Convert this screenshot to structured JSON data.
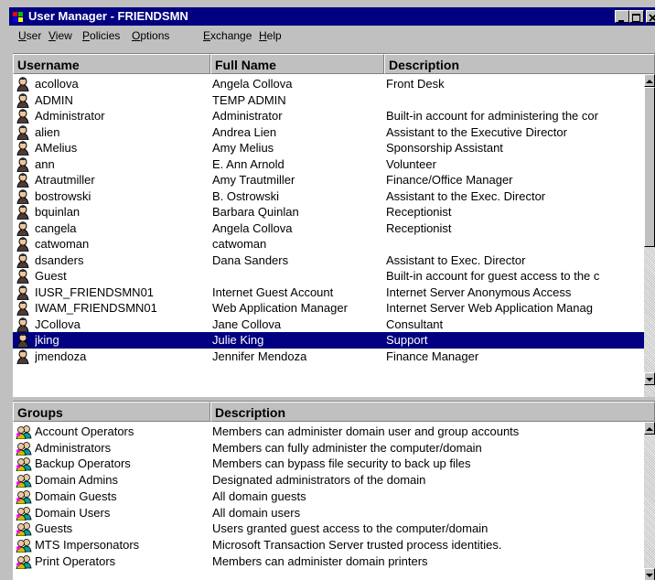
{
  "window": {
    "title": "User Manager - FRIENDSMN"
  },
  "menu": [
    "User",
    "View",
    "Policies",
    "Options",
    "Exchange",
    "Help"
  ],
  "users": {
    "columns": [
      "Username",
      "Full Name",
      "Description"
    ],
    "rows": [
      {
        "username": "acollova",
        "fullname": "Angela Collova",
        "description": "Front Desk"
      },
      {
        "username": "ADMIN",
        "fullname": "TEMP ADMIN",
        "description": ""
      },
      {
        "username": "Administrator",
        "fullname": "Administrator",
        "description": "Built-in account for administering the cor"
      },
      {
        "username": "alien",
        "fullname": "Andrea Lien",
        "description": "Assistant to the Executive Director"
      },
      {
        "username": "AMelius",
        "fullname": "Amy Melius",
        "description": "Sponsorship Assistant"
      },
      {
        "username": "ann",
        "fullname": "E. Ann Arnold",
        "description": "Volunteer"
      },
      {
        "username": "Atrautmiller",
        "fullname": "Amy Trautmiller",
        "description": "Finance/Office Manager"
      },
      {
        "username": "bostrowski",
        "fullname": "B. Ostrowski",
        "description": "Assistant to the Exec. Director"
      },
      {
        "username": "bquinlan",
        "fullname": "Barbara Quinlan",
        "description": "Receptionist"
      },
      {
        "username": "cangela",
        "fullname": "Angela Collova",
        "description": "Receptionist"
      },
      {
        "username": "catwoman",
        "fullname": "catwoman",
        "description": ""
      },
      {
        "username": "dsanders",
        "fullname": "Dana Sanders",
        "description": "Assistant to Exec. Director"
      },
      {
        "username": "Guest",
        "fullname": "",
        "description": "Built-in account for guest access to the c"
      },
      {
        "username": "IUSR_FRIENDSMN01",
        "fullname": "Internet Guest Account",
        "description": "Internet Server Anonymous Access"
      },
      {
        "username": "IWAM_FRIENDSMN01",
        "fullname": "Web Application Manager",
        "description": "Internet Server Web Application Manag"
      },
      {
        "username": "JCollova",
        "fullname": "Jane Collova",
        "description": "Consultant"
      },
      {
        "username": "jking",
        "fullname": "Julie King",
        "description": "Support",
        "selected": true
      },
      {
        "username": "jmendoza",
        "fullname": "Jennifer Mendoza",
        "description": "Finance Manager"
      }
    ]
  },
  "groups": {
    "columns": [
      "Groups",
      "Description"
    ],
    "rows": [
      {
        "name": "Account Operators",
        "description": "Members can administer domain user and group accounts"
      },
      {
        "name": "Administrators",
        "description": "Members can fully administer the computer/domain"
      },
      {
        "name": "Backup Operators",
        "description": "Members can bypass file security to back up files"
      },
      {
        "name": "Domain Admins",
        "description": "Designated administrators of the domain"
      },
      {
        "name": "Domain Guests",
        "description": "All domain guests"
      },
      {
        "name": "Domain Users",
        "description": "All domain users"
      },
      {
        "name": "Guests",
        "description": "Users granted guest access to the computer/domain"
      },
      {
        "name": "MTS Impersonators",
        "description": "Microsoft Transaction Server trusted process identities."
      },
      {
        "name": "Print Operators",
        "description": "Members can administer domain printers"
      }
    ]
  },
  "colors": {
    "titlebar": "#000080",
    "selection": "#000080",
    "face": "#c0c0c0"
  },
  "icons": {
    "user": "user-icon",
    "group": "group-icon"
  }
}
